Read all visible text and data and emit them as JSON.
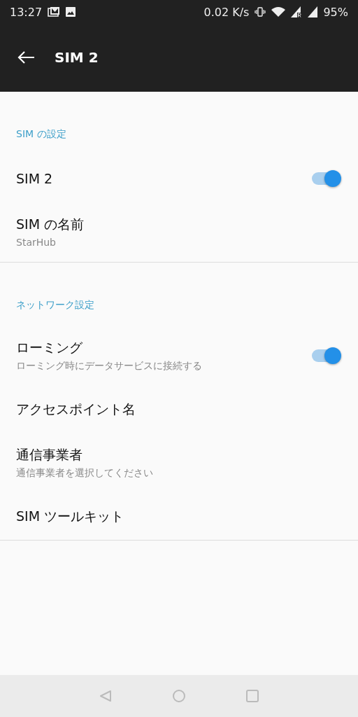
{
  "status_bar": {
    "time": "13:27",
    "speed": "0.02 K/s",
    "battery": "95%"
  },
  "app_bar": {
    "title": "SIM 2"
  },
  "sections": [
    {
      "header": "SIM の設定",
      "items": [
        {
          "kind": "switch",
          "title": "SIM 2",
          "on": true
        },
        {
          "kind": "plain",
          "title": "SIM の名前",
          "subtitle": "StarHub"
        }
      ]
    },
    {
      "header": "ネットワーク設定",
      "items": [
        {
          "kind": "switch",
          "title": "ローミング",
          "subtitle": "ローミング時にデータサービスに接続する",
          "on": true
        },
        {
          "kind": "plain",
          "title": "アクセスポイント名"
        },
        {
          "kind": "plain",
          "title": "通信事業者",
          "subtitle": "通信事業者を選択してください"
        },
        {
          "kind": "plain",
          "title": "SIM ツールキット"
        }
      ]
    }
  ]
}
